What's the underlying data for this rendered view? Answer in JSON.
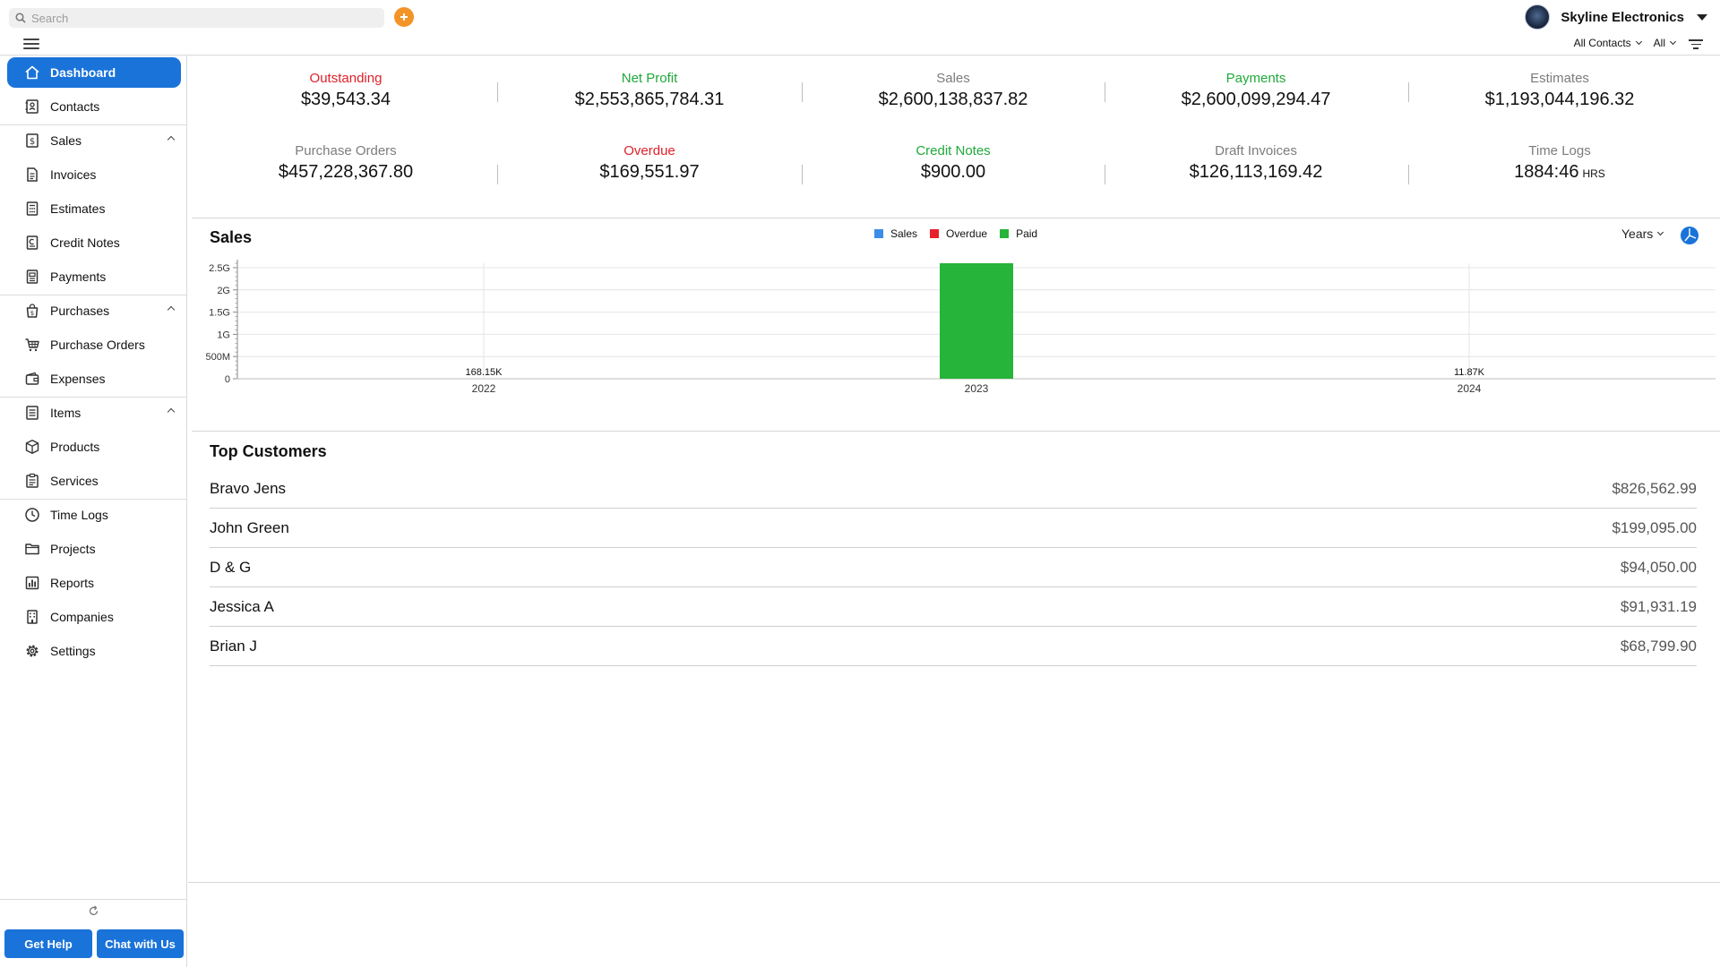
{
  "search": {
    "placeholder": "Search"
  },
  "company": {
    "name": "Skyline Electronics"
  },
  "filters": {
    "contacts": "All Contacts",
    "scope": "All"
  },
  "sidebar": {
    "items": [
      {
        "label": "Dashboard",
        "icon": "home-icon"
      },
      {
        "label": "Contacts",
        "icon": "contacts-book-icon"
      },
      {
        "label": "Sales",
        "icon": "dollar-document-icon"
      },
      {
        "label": "Invoices",
        "icon": "invoice-icon"
      },
      {
        "label": "Estimates",
        "icon": "calculator-icon"
      },
      {
        "label": "Credit Notes",
        "icon": "credit-note-icon"
      },
      {
        "label": "Payments",
        "icon": "payment-icon"
      },
      {
        "label": "Purchases",
        "icon": "purchase-bag-icon"
      },
      {
        "label": "Purchase Orders",
        "icon": "cart-icon"
      },
      {
        "label": "Expenses",
        "icon": "wallet-icon"
      },
      {
        "label": "Items",
        "icon": "items-list-icon"
      },
      {
        "label": "Products",
        "icon": "box-icon"
      },
      {
        "label": "Services",
        "icon": "clipboard-icon"
      },
      {
        "label": "Time Logs",
        "icon": "clock-icon"
      },
      {
        "label": "Projects",
        "icon": "folder-icon"
      },
      {
        "label": "Reports",
        "icon": "bar-chart-icon"
      },
      {
        "label": "Companies",
        "icon": "building-icon"
      },
      {
        "label": "Settings",
        "icon": "gear-icon"
      }
    ],
    "help_label": "Get Help",
    "chat_label": "Chat with Us"
  },
  "stats": [
    {
      "label": "Outstanding",
      "value": "$39,543.34",
      "color": "#e0202a"
    },
    {
      "label": "Net Profit",
      "value": "$2,553,865,784.31",
      "color": "#1fa93a"
    },
    {
      "label": "Sales",
      "value": "$2,600,138,837.82",
      "color": "#7c7c7c"
    },
    {
      "label": "Payments",
      "value": "$2,600,099,294.47",
      "color": "#1fa93a"
    },
    {
      "label": "Estimates",
      "value": "$1,193,044,196.32",
      "color": "#7c7c7c"
    },
    {
      "label": "Purchase Orders",
      "value": "$457,228,367.80",
      "color": "#7c7c7c"
    },
    {
      "label": "Overdue",
      "value": "$169,551.97",
      "color": "#e0202a"
    },
    {
      "label": "Credit Notes",
      "value": "$900.00",
      "color": "#1fa93a"
    },
    {
      "label": "Draft Invoices",
      "value": "$126,113,169.42",
      "color": "#7c7c7c"
    },
    {
      "label": "Time Logs",
      "value": "1884:46",
      "unit": "HRS",
      "color": "#7c7c7c"
    }
  ],
  "sales_section": {
    "title": "Sales",
    "period": "Years"
  },
  "chart_data": {
    "type": "bar",
    "categories": [
      "2022",
      "2023",
      "2024"
    ],
    "series": [
      {
        "name": "Sales",
        "color": "#3b8ee8",
        "values": [
          null,
          null,
          null
        ]
      },
      {
        "name": "Overdue",
        "color": "#e8202d",
        "values": [
          null,
          null,
          null
        ]
      },
      {
        "name": "Paid",
        "color": "#27b43a",
        "values": [
          168150,
          2600000000,
          11870
        ]
      }
    ],
    "data_labels": [
      "168.15K",
      "",
      "11.87K"
    ],
    "y_ticks": [
      "0",
      "500M",
      "1G",
      "1.5G",
      "2G",
      "2.5G"
    ],
    "ylim": [
      0,
      2600000000
    ],
    "legend": "top-center",
    "grid": true
  },
  "top_customers": {
    "title": "Top Customers",
    "rows": [
      {
        "name": "Bravo Jens",
        "amount": "$826,562.99"
      },
      {
        "name": "John Green",
        "amount": "$199,095.00"
      },
      {
        "name": "D & G",
        "amount": "$94,050.00"
      },
      {
        "name": "Jessica A",
        "amount": "$91,931.19"
      },
      {
        "name": "Brian J",
        "amount": "$68,799.90"
      }
    ]
  }
}
